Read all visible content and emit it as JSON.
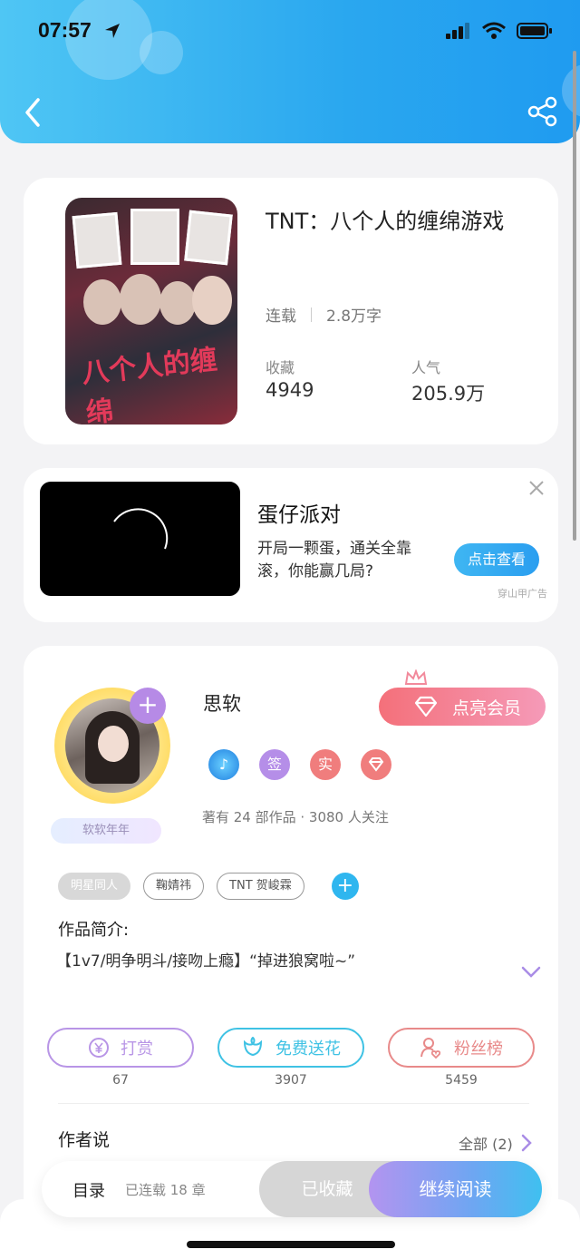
{
  "status_bar": {
    "time": "07:57"
  },
  "book": {
    "title": "TNT：八个人的缠绵游戏",
    "status": "连载",
    "word_count": "2.8万字",
    "favorites_label": "收藏",
    "favorites_value": "4949",
    "popularity_label": "人气",
    "popularity_value": "205.9万",
    "cover_title": "八个人的缠绵"
  },
  "ad": {
    "title": "蛋仔派对",
    "description": "开局一颗蛋，通关全靠滚，你能赢几局?",
    "button": "点击查看",
    "source": "穿山甲广告"
  },
  "author": {
    "name": "思软",
    "vip_button": "点亮会员",
    "avatar_tag": "软软年年",
    "badges": [
      "签",
      "实"
    ],
    "stats": "著有 24 部作品 · 3080 人关注"
  },
  "tags": [
    "明星同人",
    "鞠婧祎",
    "TNT 贺峻霖"
  ],
  "intro": {
    "label": "作品简介:",
    "text": "【1v7/明争明斗/接吻上瘾】“掉进狼窝啦~”"
  },
  "actions": [
    {
      "label": "打赏",
      "count": "67",
      "color": "#b895e6"
    },
    {
      "label": "免费送花",
      "count": "3907",
      "color": "#3fc2e4"
    },
    {
      "label": "粉丝榜",
      "count": "5459",
      "color": "#e88a8a"
    }
  ],
  "author_say": {
    "label": "作者说",
    "all_link": "全部 (2)"
  },
  "bottom_bar": {
    "toc": "目录",
    "chapters": "已连载 18 章",
    "collected": "已收藏",
    "continue": "继续阅读"
  }
}
